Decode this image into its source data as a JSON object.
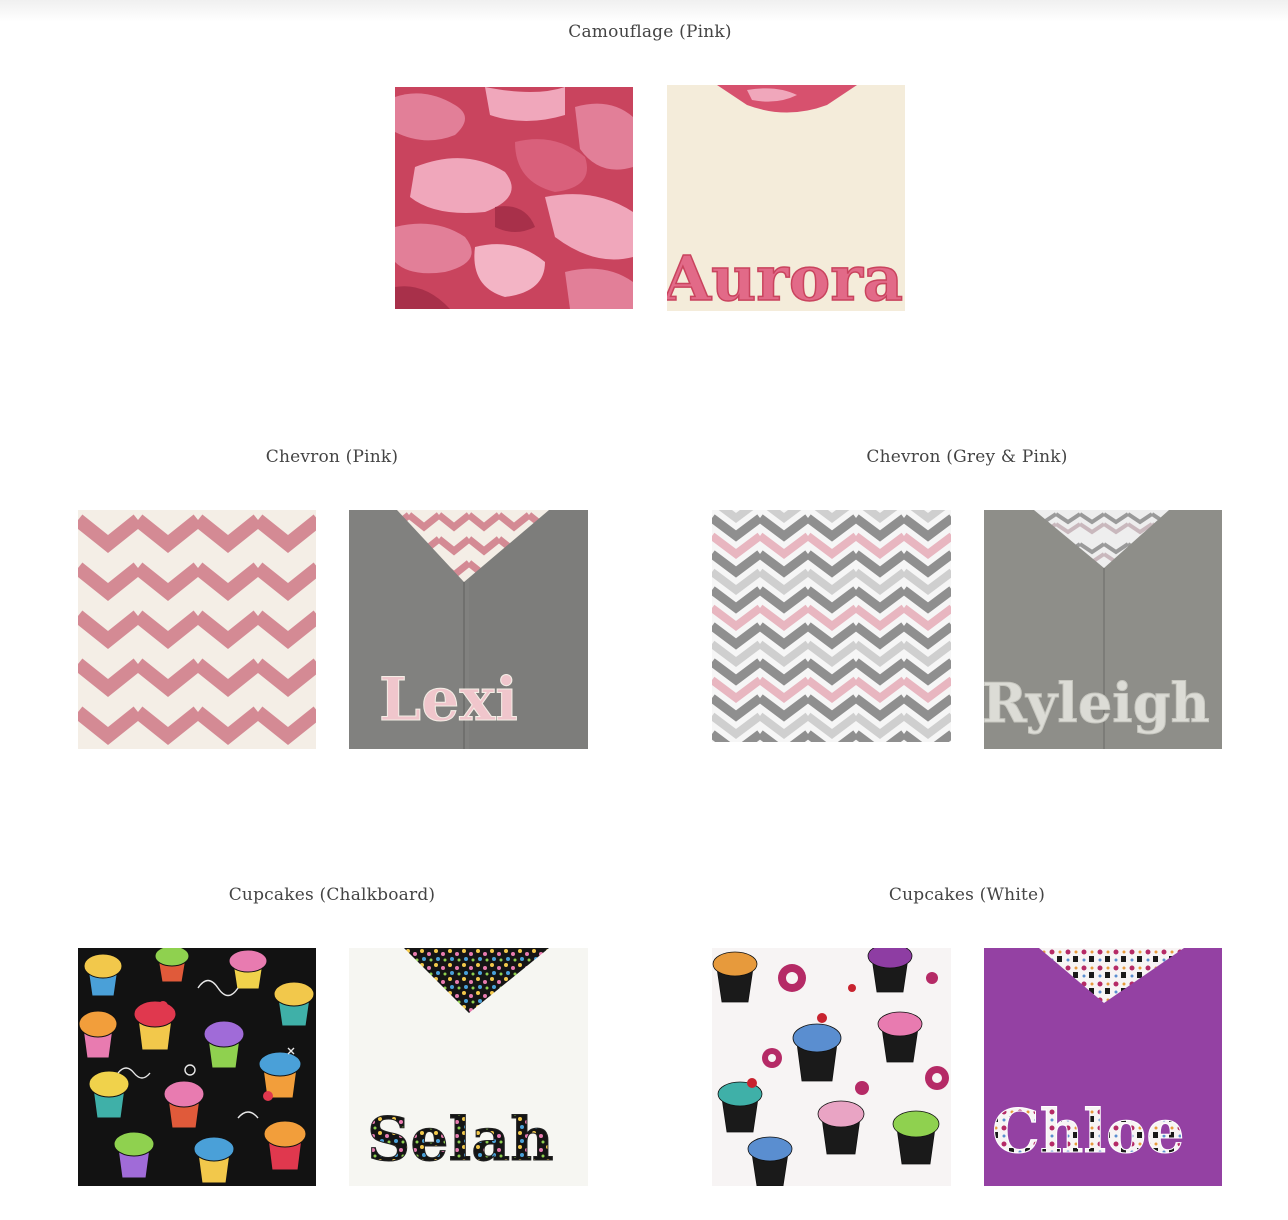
{
  "products": [
    {
      "id": "camouflage-pink",
      "title": "Camouflage (Pink)",
      "fabric_icon": "pink-camouflage-fabric-swatch",
      "towel_icon": "cream-towel-pink-camo-appliqué",
      "towel_name": "Aurora",
      "colors": {
        "base": "#c9445e",
        "accent": "#e88aa4",
        "towel": "#f4ecda"
      }
    },
    {
      "id": "chevron-pink",
      "title": "Chevron (Pink)",
      "fabric_icon": "pink-chevron-fabric-swatch",
      "towel_icon": "grey-towel-pink-chevron-appliqué",
      "towel_name": "Lexi",
      "colors": {
        "base": "#d48a94",
        "accent": "#f4eee6",
        "towel": "#7d7d7b"
      }
    },
    {
      "id": "chevron-grey-pink",
      "title": "Chevron (Grey & Pink)",
      "fabric_icon": "grey-pink-chevron-fabric-swatch",
      "towel_icon": "grey-towel-grey-chevron-appliqué",
      "towel_name": "Ryleigh",
      "colors": {
        "base": "#8f8f8f",
        "accent": "#e8b6c0",
        "towel": "#8a8a86"
      }
    },
    {
      "id": "cupcakes-chalkboard",
      "title": "Cupcakes (Chalkboard)",
      "fabric_icon": "chalkboard-cupcakes-fabric-swatch",
      "towel_icon": "white-towel-chalkboard-cupcake-appliqué",
      "towel_name": "Selah",
      "colors": {
        "base": "#121212",
        "accent": "#f2c84b",
        "towel": "#f6f6f2"
      }
    },
    {
      "id": "cupcakes-white",
      "title": "Cupcakes (White)",
      "fabric_icon": "white-cupcakes-fabric-swatch",
      "towel_icon": "purple-towel-white-cupcake-appliqué",
      "towel_name": "Chloe",
      "colors": {
        "base": "#f7f4f4",
        "accent": "#b52a66",
        "towel": "#8e3d9e"
      }
    }
  ]
}
